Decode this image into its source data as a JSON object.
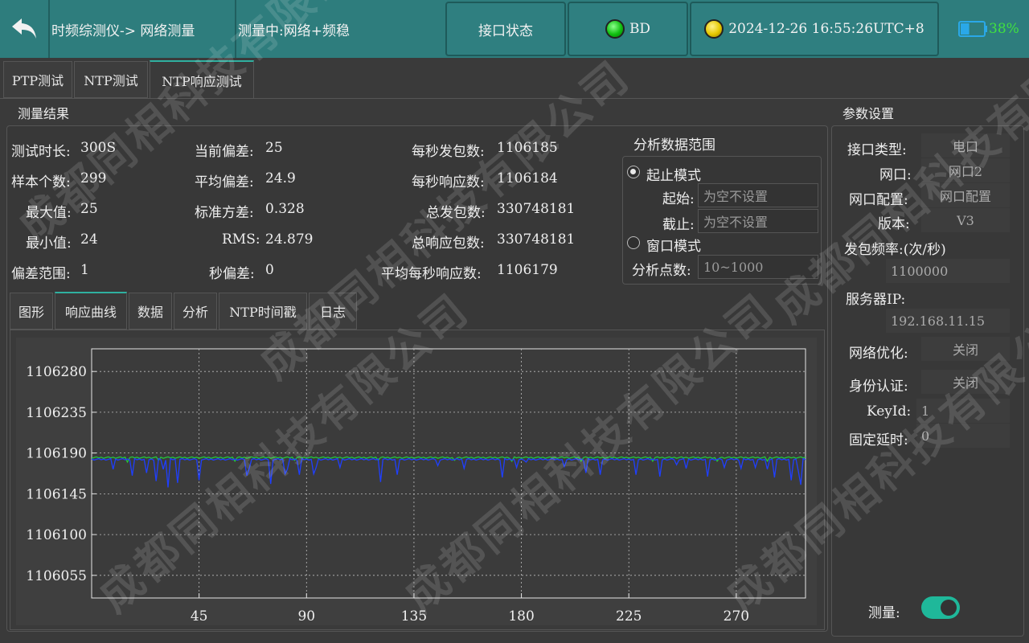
{
  "header": {
    "breadcrumb": "时频综测仪-> 网络测量",
    "status": "测量中:网络+频稳",
    "interface_button": "接口状态",
    "bd_label": "BD",
    "datetime": "2024-12-26 16:55:26UTC+8",
    "battery_percent": "38%",
    "battery_level": 0.38,
    "bd_led_color": "#10c010",
    "time_led_color": "#e6c800"
  },
  "tabs": [
    "PTP测试",
    "NTP测试",
    "NTP响应测试"
  ],
  "active_tab": 2,
  "results": {
    "title": "测量结果",
    "col1": [
      {
        "label": "测试时长:",
        "value": "300S"
      },
      {
        "label": "样本个数:",
        "value": "299"
      },
      {
        "label": "最大值:",
        "value": "25"
      },
      {
        "label": "最小值:",
        "value": "24"
      },
      {
        "label": "偏差范围:",
        "value": "1"
      }
    ],
    "col2": [
      {
        "label": "当前偏差:",
        "value": "25"
      },
      {
        "label": "平均偏差:",
        "value": "24.9"
      },
      {
        "label": "标准方差:",
        "value": "0.328"
      },
      {
        "label": "RMS:",
        "value": "24.879"
      },
      {
        "label": "秒偏差:",
        "value": "0"
      }
    ],
    "col3": [
      {
        "label": "每秒发包数:",
        "value": "1106185"
      },
      {
        "label": "每秒响应数:",
        "value": "1106184"
      },
      {
        "label": "总发包数:",
        "value": "330748181"
      },
      {
        "label": "总响应包数:",
        "value": "330748181"
      },
      {
        "label": "平均每秒响应数:",
        "value": "1106179"
      }
    ]
  },
  "range": {
    "title": "分析数据范围",
    "mode1": "起止模式",
    "start_label": "起始:",
    "start_placeholder": "为空不设置",
    "end_label": "截止:",
    "end_placeholder": "为空不设置",
    "mode2": "窗口模式",
    "points_label": "分析点数:",
    "points_placeholder": "10~1000"
  },
  "subtabs": [
    "图形",
    "响应曲线",
    "数据",
    "分析",
    "NTP时间戳",
    "日志"
  ],
  "active_subtab": 1,
  "params": {
    "title": "参数设置",
    "iface_type_label": "接口类型:",
    "iface_type_value": "电口",
    "port_label": "网口:",
    "port_value": "网口2",
    "port_cfg_label": "网口配置:",
    "port_cfg_value": "网口配置",
    "version_label": "版本:",
    "version_value": "V3",
    "rate_label": "发包频率:(次/秒)",
    "rate_value": "1100000",
    "server_label": "服务器IP:",
    "server_value": "192.168.11.15",
    "opt_label": "网络优化:",
    "opt_value": "关闭",
    "auth_label": "身份认证:",
    "auth_value": "关闭",
    "keyid_label": "KeyId:",
    "keyid_value": "1",
    "delay_label": "固定延时:",
    "delay_value": "0",
    "measure_label": "测量:",
    "measure_on": true
  },
  "watermark": "成都同相科技有限公司",
  "chart_data": {
    "type": "line",
    "x_ticks": [
      45,
      90,
      135,
      180,
      225,
      270
    ],
    "y_ticks": [
      1106280,
      1106235,
      1106190,
      1106145,
      1106100,
      1106055
    ],
    "xlim": [
      0,
      299
    ],
    "ylim": [
      1106030,
      1106305
    ],
    "grid": true,
    "series": [
      {
        "color": "#22c83a",
        "baseline": 1106185,
        "dips": [
          [
            0,
            1106184
          ],
          [
            15,
            1106180
          ],
          [
            28,
            1106182
          ],
          [
            60,
            1106181
          ],
          [
            85,
            1106182
          ],
          [
            120,
            1106182
          ],
          [
            152,
            1106182
          ],
          [
            176,
            1106181
          ],
          [
            205,
            1106181
          ],
          [
            235,
            1106181
          ],
          [
            262,
            1106181
          ],
          [
            283,
            1106181
          ]
        ]
      },
      {
        "color": "#1f3fff",
        "baseline": 1106183,
        "dips": [
          [
            9,
            1106172
          ],
          [
            17,
            1106165
          ],
          [
            23,
            1106168
          ],
          [
            27,
            1106159
          ],
          [
            30,
            1106172
          ],
          [
            32,
            1106152
          ],
          [
            36,
            1106157
          ],
          [
            45,
            1106160
          ],
          [
            65,
            1106165
          ],
          [
            66,
            1106173
          ],
          [
            75,
            1106156
          ],
          [
            81,
            1106167
          ],
          [
            82,
            1106172
          ],
          [
            87,
            1106166
          ],
          [
            93,
            1106167
          ],
          [
            94,
            1106174
          ],
          [
            104,
            1106174
          ],
          [
            121,
            1106158
          ],
          [
            128,
            1106166
          ],
          [
            145,
            1106176
          ],
          [
            156,
            1106173
          ],
          [
            172,
            1106163
          ],
          [
            178,
            1106174
          ],
          [
            182,
            1106180
          ],
          [
            198,
            1106175
          ],
          [
            207,
            1106168
          ],
          [
            213,
            1106166
          ],
          [
            228,
            1106166
          ],
          [
            238,
            1106164
          ],
          [
            245,
            1106177
          ],
          [
            249,
            1106173
          ],
          [
            258,
            1106164
          ],
          [
            265,
            1106174
          ],
          [
            272,
            1106173
          ],
          [
            278,
            1106174
          ],
          [
            283,
            1106172
          ],
          [
            286,
            1106163
          ],
          [
            293,
            1106160
          ],
          [
            296,
            1106170
          ],
          [
            297,
            1106155
          ]
        ]
      }
    ]
  }
}
